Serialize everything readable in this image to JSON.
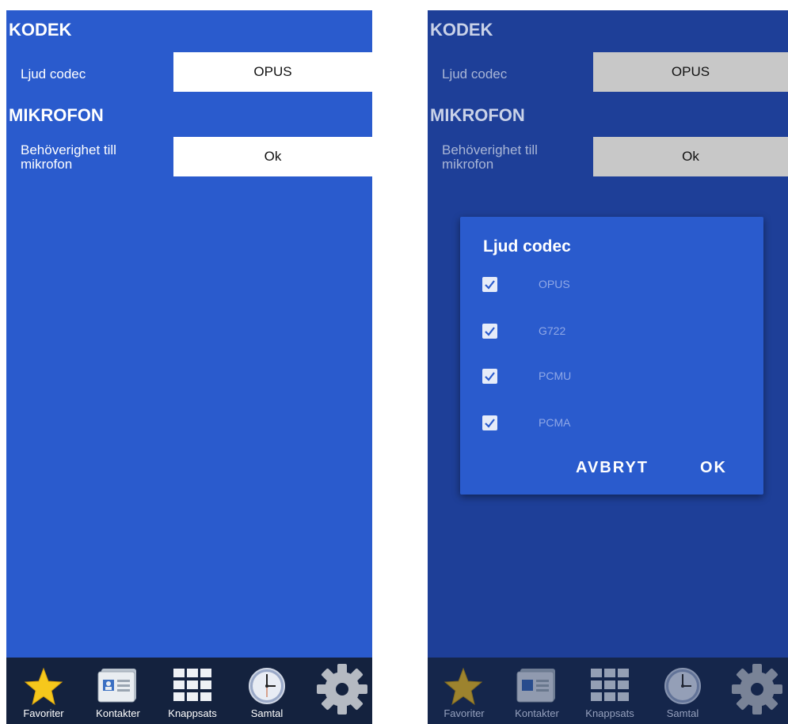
{
  "left": {
    "sections": {
      "codec_title": "KODEK",
      "codec_label": "Ljud codec",
      "codec_value": "OPUS",
      "mic_title": "MIKROFON",
      "mic_label_1": "Behöverighet till",
      "mic_label_2": "mikrofon",
      "mic_value": "Ok"
    }
  },
  "right": {
    "sections": {
      "codec_title": "KODEK",
      "codec_label": "Ljud codec",
      "codec_value": "OPUS",
      "mic_title": "MIKROFON",
      "mic_label_1": "Behöverighet till",
      "mic_label_2": "mikrofon",
      "mic_value": "Ok"
    },
    "dialog": {
      "title": "Ljud codec",
      "options": [
        {
          "label": "OPUS",
          "checked": true
        },
        {
          "label": "G722",
          "checked": true
        },
        {
          "label": "PCMU",
          "checked": true
        },
        {
          "label": "PCMA",
          "checked": true
        }
      ],
      "cancel_label": "AVBRYT",
      "ok_label": "OK"
    }
  },
  "nav": {
    "items": [
      {
        "label": "Favoriter",
        "icon": "star-icon"
      },
      {
        "label": "Kontakter",
        "icon": "contact-card-icon"
      },
      {
        "label": "Knappsats",
        "icon": "keypad-icon"
      },
      {
        "label": "Samtal",
        "icon": "clock-icon"
      },
      {
        "label": "",
        "icon": "gear-icon"
      }
    ]
  },
  "colors": {
    "background_blue": "#2a5bcd",
    "dimmed_blue": "#1e3f98",
    "nav_bg": "#14223e",
    "star_yellow": "#f6c81c"
  }
}
